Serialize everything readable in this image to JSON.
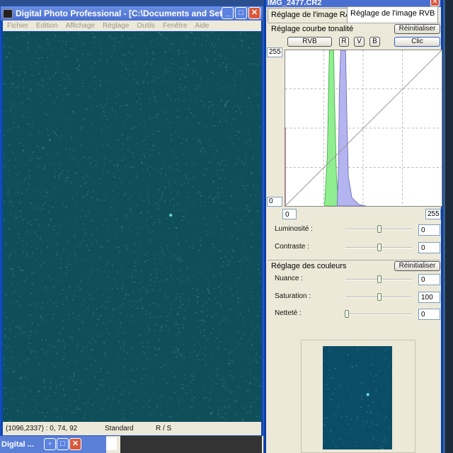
{
  "main_window": {
    "title": "Digital Photo Professional - [C:\\Documents and Set...",
    "menu": [
      "Fichier",
      "Edition",
      "Affichage",
      "Réglage",
      "Outils",
      "Fenêtre",
      "Aide"
    ],
    "status": {
      "coords": "(1096,2337) :  0, 74, 92",
      "style": "Standard",
      "mode": "R / S"
    }
  },
  "taskbar": {
    "label": "Digital ..."
  },
  "panel": {
    "title": "IMG_2477.CR2",
    "tabs": [
      {
        "label": "Réglage de l'image RAW"
      },
      {
        "label": "Réglage de l'image RVB"
      }
    ],
    "curve": {
      "header": "Réglage courbe tonalité",
      "reset": "Réinitialiser",
      "channels": [
        "RVB",
        "R",
        "V",
        "B"
      ],
      "clic": "Clic",
      "y_max": "255",
      "y_min": "0",
      "x_min": "0",
      "x_max": "255"
    },
    "brightness": {
      "label": "Luminosité :",
      "value": "0",
      "position": 0.5
    },
    "contrast": {
      "label": "Contraste :",
      "value": "0",
      "position": 0.5
    },
    "colors": {
      "header": "Réglage des couleurs",
      "reset": "Réinitialiser"
    },
    "hue": {
      "label": "Nuance :",
      "value": "0",
      "position": 0.5
    },
    "saturation": {
      "label": "Saturation :",
      "value": "100",
      "position": 0.5
    },
    "sharpness": {
      "label": "Netteté :",
      "value": "0",
      "position": 0
    }
  },
  "colors": {
    "sky": "#0e4f5a",
    "green_hist": "#90ee90",
    "blue_hist": "#b4b4f0"
  }
}
